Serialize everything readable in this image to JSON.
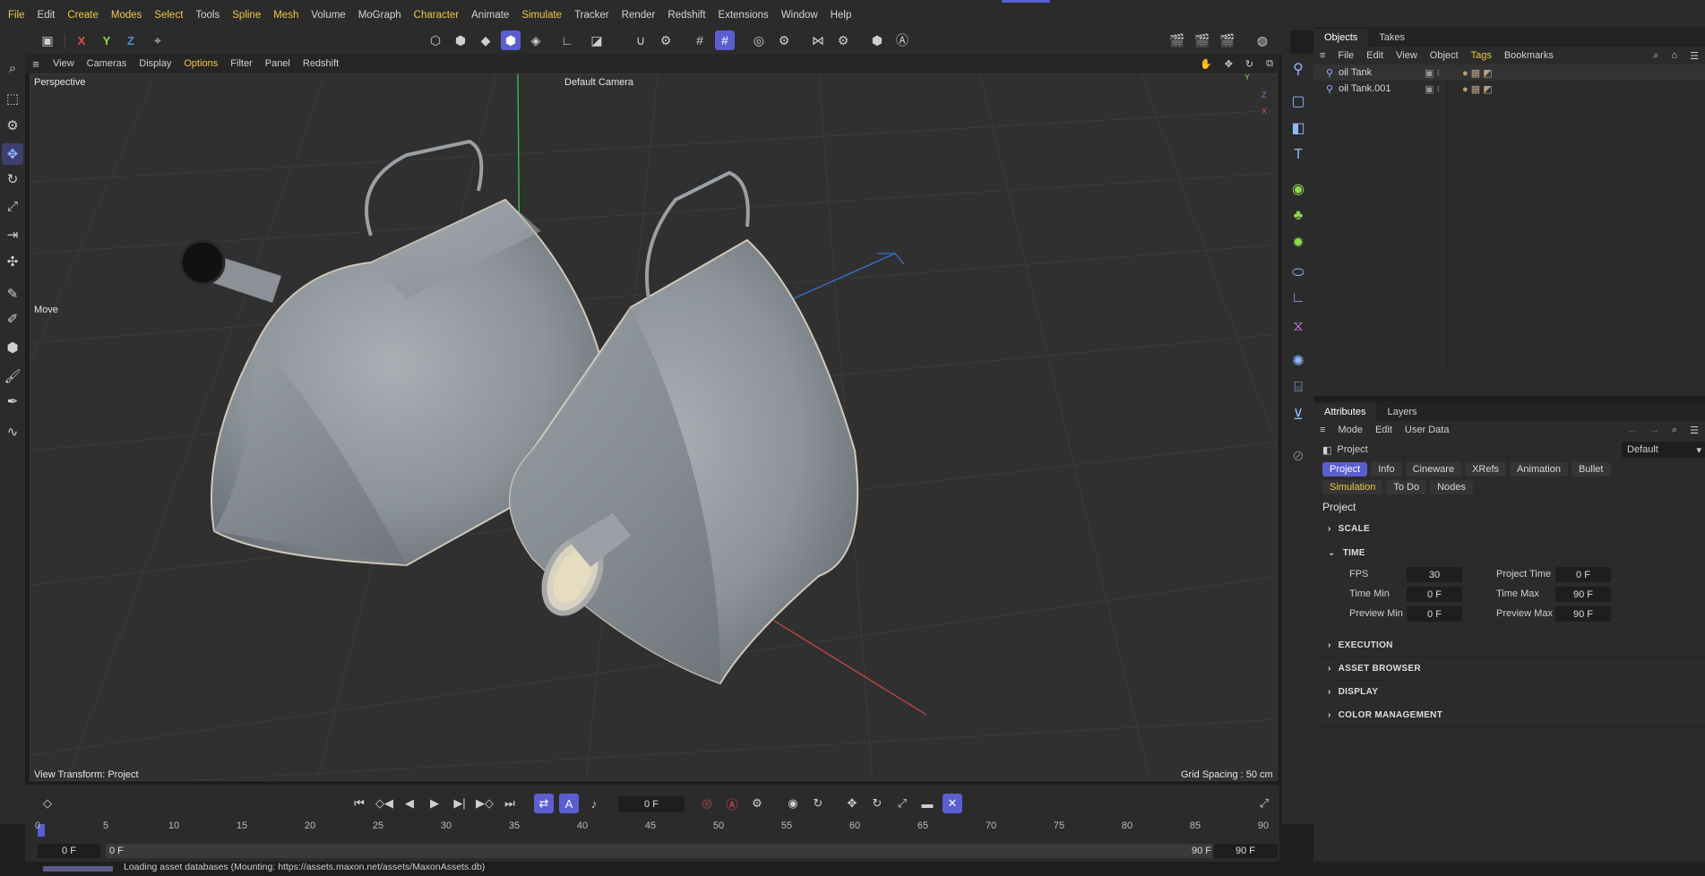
{
  "menubar": {
    "items": [
      "File",
      "Edit",
      "Create",
      "Modes",
      "Select",
      "Tools",
      "Spline",
      "Mesh",
      "Volume",
      "MoGraph",
      "Character",
      "Animate",
      "Simulate",
      "Tracker",
      "Render",
      "Redshift",
      "Extensions",
      "Window",
      "Help"
    ]
  },
  "toolbar": {
    "axes": [
      "X",
      "Y",
      "Z"
    ]
  },
  "viewport": {
    "menu": [
      "View",
      "Cameras",
      "Display",
      "Options",
      "Filter",
      "Panel",
      "Redshift"
    ],
    "perspective_label": "Perspective",
    "camera_label": "Default Camera",
    "tool_label": "Move",
    "view_transform": "View Transform: Project",
    "grid_spacing": "Grid Spacing : 50 cm",
    "gizmo": {
      "y": "Y",
      "z": "Z",
      "x": "X"
    }
  },
  "objects_panel": {
    "tabs": [
      "Objects",
      "Takes"
    ],
    "menu": [
      "File",
      "Edit",
      "View",
      "Object",
      "Tags",
      "Bookmarks"
    ],
    "items": [
      {
        "name": "oil Tank"
      },
      {
        "name": "oil Tank.001"
      }
    ]
  },
  "attributes_panel": {
    "tabs": [
      "Attributes",
      "Layers"
    ],
    "menu": [
      "Mode",
      "Edit",
      "User Data"
    ],
    "object_label": "Project",
    "preset": "Default",
    "buttons_row1": [
      "Project",
      "Info",
      "Cineware",
      "XRefs",
      "Animation",
      "Bullet"
    ],
    "buttons_row2": [
      "Simulation",
      "To Do",
      "Nodes"
    ],
    "heading": "Project",
    "sections": {
      "scale": "SCALE",
      "time": "TIME",
      "execution": "EXECUTION",
      "asset_browser": "ASSET BROWSER",
      "display": "DISPLAY",
      "color_management": "COLOR MANAGEMENT"
    },
    "time_fields": {
      "fps_label": "FPS",
      "fps": "30",
      "project_time_label": "Project Time",
      "project_time": "0 F",
      "time_min_label": "Time Min",
      "time_min": "0 F",
      "time_max_label": "Time Max",
      "time_max": "90 F",
      "preview_min_label": "Preview Min",
      "preview_min": "0 F",
      "preview_max_label": "Preview Max",
      "preview_max": "90 F"
    }
  },
  "timeline": {
    "current_frame": "0 F",
    "ruler": [
      "0",
      "5",
      "10",
      "15",
      "20",
      "25",
      "30",
      "35",
      "40",
      "45",
      "50",
      "55",
      "60",
      "65",
      "70",
      "75",
      "80",
      "85",
      "90"
    ],
    "start": "0 F",
    "range_start": "0 F",
    "range_end": "90 F",
    "end": "90 F"
  },
  "status": {
    "text": "Loading asset databases (Mounting: https://assets.maxon.net/assets/MaxonAssets.db)"
  },
  "colors": {
    "accent": "#5a5ed0",
    "highlight_text": "#f0c848",
    "axis_x": "#e05050",
    "axis_y": "#8fd94f",
    "axis_z": "#4a8fe0"
  }
}
